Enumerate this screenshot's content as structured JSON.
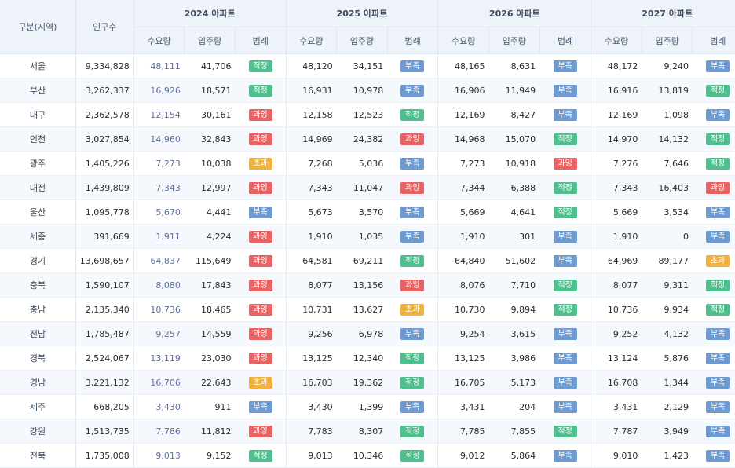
{
  "header": {
    "region_label": "구분(지역)",
    "population_label": "인구수",
    "years": [
      {
        "label": "2024 아파트"
      },
      {
        "label": "2025 아파트"
      },
      {
        "label": "2026 아파트"
      },
      {
        "label": "2027 아파트"
      }
    ],
    "sub_labels": {
      "demand": "수요량",
      "move_in": "입주량",
      "legend": "범례"
    }
  },
  "badge_colors": {
    "적정": "#4fc08d",
    "부족": "#6d9bd1",
    "과잉": "#e86464",
    "초과": "#f0b23c"
  },
  "rows": [
    {
      "region": "서울",
      "population": "9,334,828",
      "y2024": {
        "demand": "48,111",
        "move_in": "41,706",
        "status": "적정"
      },
      "y2025": {
        "demand": "48,120",
        "move_in": "34,151",
        "status": "부족"
      },
      "y2026": {
        "demand": "48,165",
        "move_in": "8,631",
        "status": "부족"
      },
      "y2027": {
        "demand": "48,172",
        "move_in": "9,240",
        "status": "부족"
      }
    },
    {
      "region": "부산",
      "population": "3,262,337",
      "y2024": {
        "demand": "16,926",
        "move_in": "18,571",
        "status": "적정"
      },
      "y2025": {
        "demand": "16,931",
        "move_in": "10,978",
        "status": "부족"
      },
      "y2026": {
        "demand": "16,906",
        "move_in": "11,949",
        "status": "부족"
      },
      "y2027": {
        "demand": "16,916",
        "move_in": "13,819",
        "status": "적정"
      }
    },
    {
      "region": "대구",
      "population": "2,362,578",
      "y2024": {
        "demand": "12,154",
        "move_in": "30,161",
        "status": "과잉"
      },
      "y2025": {
        "demand": "12,158",
        "move_in": "12,523",
        "status": "적정"
      },
      "y2026": {
        "demand": "12,169",
        "move_in": "8,427",
        "status": "부족"
      },
      "y2027": {
        "demand": "12,169",
        "move_in": "1,098",
        "status": "부족"
      }
    },
    {
      "region": "인천",
      "population": "3,027,854",
      "y2024": {
        "demand": "14,960",
        "move_in": "32,843",
        "status": "과잉"
      },
      "y2025": {
        "demand": "14,969",
        "move_in": "24,382",
        "status": "과잉"
      },
      "y2026": {
        "demand": "14,968",
        "move_in": "15,070",
        "status": "적정"
      },
      "y2027": {
        "demand": "14,970",
        "move_in": "14,132",
        "status": "적정"
      }
    },
    {
      "region": "광주",
      "population": "1,405,226",
      "y2024": {
        "demand": "7,273",
        "move_in": "10,038",
        "status": "초과"
      },
      "y2025": {
        "demand": "7,268",
        "move_in": "5,036",
        "status": "부족"
      },
      "y2026": {
        "demand": "7,273",
        "move_in": "10,918",
        "status": "과잉"
      },
      "y2027": {
        "demand": "7,276",
        "move_in": "7,646",
        "status": "적정"
      }
    },
    {
      "region": "대전",
      "population": "1,439,809",
      "y2024": {
        "demand": "7,343",
        "move_in": "12,997",
        "status": "과잉"
      },
      "y2025": {
        "demand": "7,343",
        "move_in": "11,047",
        "status": "과잉"
      },
      "y2026": {
        "demand": "7,344",
        "move_in": "6,388",
        "status": "적정"
      },
      "y2027": {
        "demand": "7,343",
        "move_in": "16,403",
        "status": "과잉"
      }
    },
    {
      "region": "울산",
      "population": "1,095,778",
      "y2024": {
        "demand": "5,670",
        "move_in": "4,441",
        "status": "부족"
      },
      "y2025": {
        "demand": "5,673",
        "move_in": "3,570",
        "status": "부족"
      },
      "y2026": {
        "demand": "5,669",
        "move_in": "4,641",
        "status": "적정"
      },
      "y2027": {
        "demand": "5,669",
        "move_in": "3,534",
        "status": "부족"
      }
    },
    {
      "region": "세종",
      "population": "391,669",
      "y2024": {
        "demand": "1,911",
        "move_in": "4,224",
        "status": "과잉"
      },
      "y2025": {
        "demand": "1,910",
        "move_in": "1,035",
        "status": "부족"
      },
      "y2026": {
        "demand": "1,910",
        "move_in": "301",
        "status": "부족"
      },
      "y2027": {
        "demand": "1,910",
        "move_in": "0",
        "status": "부족"
      }
    },
    {
      "region": "경기",
      "population": "13,698,657",
      "y2024": {
        "demand": "64,837",
        "move_in": "115,649",
        "status": "과잉"
      },
      "y2025": {
        "demand": "64,581",
        "move_in": "69,211",
        "status": "적정"
      },
      "y2026": {
        "demand": "64,840",
        "move_in": "51,602",
        "status": "부족"
      },
      "y2027": {
        "demand": "64,969",
        "move_in": "89,177",
        "status": "초과"
      }
    },
    {
      "region": "충북",
      "population": "1,590,107",
      "y2024": {
        "demand": "8,080",
        "move_in": "17,843",
        "status": "과잉"
      },
      "y2025": {
        "demand": "8,077",
        "move_in": "13,156",
        "status": "과잉"
      },
      "y2026": {
        "demand": "8,076",
        "move_in": "7,710",
        "status": "적정"
      },
      "y2027": {
        "demand": "8,077",
        "move_in": "9,311",
        "status": "적정"
      }
    },
    {
      "region": "충남",
      "population": "2,135,340",
      "y2024": {
        "demand": "10,736",
        "move_in": "18,465",
        "status": "과잉"
      },
      "y2025": {
        "demand": "10,731",
        "move_in": "13,627",
        "status": "초과"
      },
      "y2026": {
        "demand": "10,730",
        "move_in": "9,894",
        "status": "적정"
      },
      "y2027": {
        "demand": "10,736",
        "move_in": "9,934",
        "status": "적정"
      }
    },
    {
      "region": "전남",
      "population": "1,785,487",
      "y2024": {
        "demand": "9,257",
        "move_in": "14,559",
        "status": "과잉"
      },
      "y2025": {
        "demand": "9,256",
        "move_in": "6,978",
        "status": "부족"
      },
      "y2026": {
        "demand": "9,254",
        "move_in": "3,615",
        "status": "부족"
      },
      "y2027": {
        "demand": "9,252",
        "move_in": "4,132",
        "status": "부족"
      }
    },
    {
      "region": "경북",
      "population": "2,524,067",
      "y2024": {
        "demand": "13,119",
        "move_in": "23,030",
        "status": "과잉"
      },
      "y2025": {
        "demand": "13,125",
        "move_in": "12,340",
        "status": "적정"
      },
      "y2026": {
        "demand": "13,125",
        "move_in": "3,986",
        "status": "부족"
      },
      "y2027": {
        "demand": "13,124",
        "move_in": "5,876",
        "status": "부족"
      }
    },
    {
      "region": "경남",
      "population": "3,221,132",
      "y2024": {
        "demand": "16,706",
        "move_in": "22,643",
        "status": "초과"
      },
      "y2025": {
        "demand": "16,703",
        "move_in": "19,362",
        "status": "적정"
      },
      "y2026": {
        "demand": "16,705",
        "move_in": "5,173",
        "status": "부족"
      },
      "y2027": {
        "demand": "16,708",
        "move_in": "1,344",
        "status": "부족"
      }
    },
    {
      "region": "제주",
      "population": "668,205",
      "y2024": {
        "demand": "3,430",
        "move_in": "911",
        "status": "부족"
      },
      "y2025": {
        "demand": "3,430",
        "move_in": "1,399",
        "status": "부족"
      },
      "y2026": {
        "demand": "3,431",
        "move_in": "204",
        "status": "부족"
      },
      "y2027": {
        "demand": "3,431",
        "move_in": "2,129",
        "status": "부족"
      }
    },
    {
      "region": "강원",
      "population": "1,513,735",
      "y2024": {
        "demand": "7,786",
        "move_in": "11,812",
        "status": "과잉"
      },
      "y2025": {
        "demand": "7,783",
        "move_in": "8,307",
        "status": "적정"
      },
      "y2026": {
        "demand": "7,785",
        "move_in": "7,855",
        "status": "적정"
      },
      "y2027": {
        "demand": "7,787",
        "move_in": "3,949",
        "status": "부족"
      }
    },
    {
      "region": "전북",
      "population": "1,735,008",
      "y2024": {
        "demand": "9,013",
        "move_in": "9,152",
        "status": "적정"
      },
      "y2025": {
        "demand": "9,013",
        "move_in": "10,346",
        "status": "적정"
      },
      "y2026": {
        "demand": "9,012",
        "move_in": "5,864",
        "status": "부족"
      },
      "y2027": {
        "demand": "9,010",
        "move_in": "1,423",
        "status": "부족"
      }
    }
  ]
}
